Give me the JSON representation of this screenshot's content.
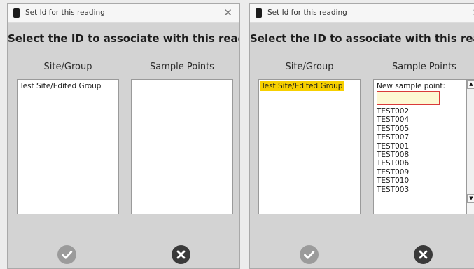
{
  "left_dialog": {
    "title": "Set Id for this reading",
    "close_glyph": "✕",
    "heading": "Select the ID to associate with this reading",
    "site_group_label": "Site/Group",
    "sample_points_label": "Sample Points",
    "site_items": [
      {
        "label": "Test Site/Edited Group",
        "selected": false
      }
    ]
  },
  "right_dialog": {
    "title": "Set Id for this reading",
    "close_glyph": "✕",
    "heading": "Select the ID to associate with this reading",
    "site_group_label": "Site/Group",
    "sample_points_label": "Sample Points",
    "site_items": [
      {
        "label": "Test Site/Edited Group",
        "selected": true
      }
    ],
    "new_sample_point_label": "New sample point:",
    "new_sample_point_value": "",
    "sample_points": [
      "TEST002",
      "TEST004",
      "TEST005",
      "TEST007",
      "TEST001",
      "TEST008",
      "TEST006",
      "TEST009",
      "TEST010",
      "TEST003"
    ]
  },
  "icons": {
    "ok": "checkmark-icon",
    "cancel": "close-circle-icon",
    "scroll_up": "scroll-up-arrow-icon",
    "scroll_down": "scroll-down-arrow-icon",
    "app": "app-icon"
  },
  "colors": {
    "dialog_bg": "#d3d3d3",
    "selection": "#f7d000",
    "input_bg": "#fdf8d3",
    "input_border": "#d93a3a",
    "ok_button": "#9b9b9b",
    "cancel_button": "#3a3a3a"
  }
}
